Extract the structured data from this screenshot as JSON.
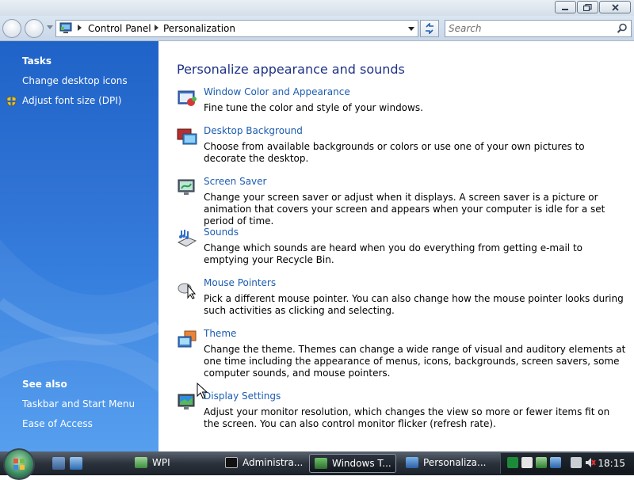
{
  "window": {
    "breadcrumb": [
      "Control Panel",
      "Personalization"
    ],
    "search_placeholder": "Search"
  },
  "sidebar": {
    "tasks_heading": "Tasks",
    "tasks": [
      {
        "label": "Change desktop icons",
        "icon": null
      },
      {
        "label": "Adjust font size (DPI)",
        "icon": "uac-shield-icon"
      }
    ],
    "see_also_heading": "See also",
    "see_also": [
      "Taskbar and Start Menu",
      "Ease of Access"
    ]
  },
  "main": {
    "title": "Personalize appearance and sounds",
    "items": [
      {
        "link": "Window Color and Appearance",
        "desc": "Fine tune the color and style of your windows.",
        "icon": "window-color-icon"
      },
      {
        "link": "Desktop Background",
        "desc": "Choose from available backgrounds or colors or use one of your own pictures to decorate the desktop.",
        "icon": "desktop-background-icon"
      },
      {
        "link": "Screen Saver",
        "desc": "Change your screen saver or adjust when it displays. A screen saver is a picture or animation that covers your screen and appears when your computer is idle for a set period of time.",
        "icon": "screen-saver-icon"
      },
      {
        "link": "Sounds",
        "desc": "Change which sounds are heard when you do everything from getting e-mail to emptying your Recycle Bin.",
        "icon": "sounds-icon"
      },
      {
        "link": "Mouse Pointers",
        "desc": "Pick a different mouse pointer. You can also change how the mouse pointer looks during such activities as clicking and selecting.",
        "icon": "mouse-pointers-icon"
      },
      {
        "link": "Theme",
        "desc": "Change the theme. Themes can change a wide range of visual and auditory elements at one time including the appearance of menus, icons, backgrounds, screen savers, some computer sounds, and mouse pointers.",
        "icon": "theme-icon"
      },
      {
        "link": "Display Settings",
        "desc": "Adjust your monitor resolution, which changes the view so more or fewer items fit on the screen. You can also control monitor flicker (refresh rate).",
        "icon": "display-settings-icon"
      }
    ]
  },
  "taskbar": {
    "buttons": [
      {
        "label": "WPI",
        "active": false,
        "icon": "wpi-icon"
      },
      {
        "label": "Administra...",
        "active": false,
        "icon": "cmd-icon"
      },
      {
        "label": "Windows T...",
        "active": true,
        "icon": "task-manager-icon"
      },
      {
        "label": "Personaliza...",
        "active": false,
        "icon": "personalization-icon"
      }
    ],
    "clock": "18:15"
  }
}
